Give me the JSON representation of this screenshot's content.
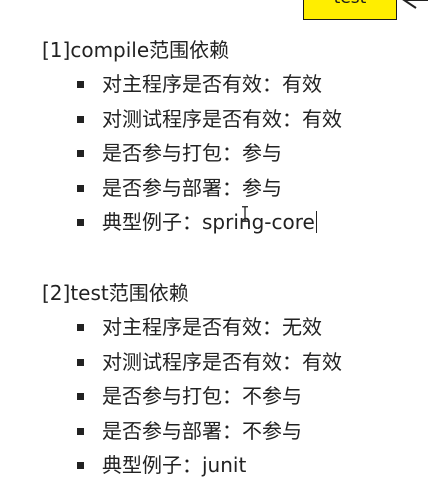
{
  "top_tag": {
    "label": "test",
    "fill_color": "#ffee00"
  },
  "sections": [
    {
      "title": "[1]compile范围依赖",
      "items": [
        "对主程序是否有效：有效",
        "对测试程序是否有效：有效",
        "是否参与打包：参与",
        "是否参与部署：参与",
        "典型例子：spring-core"
      ]
    },
    {
      "title": "[2]test范围依赖",
      "items": [
        "对主程序是否有效：无效",
        "对测试程序是否有效：有效",
        "是否参与打包：不参与",
        "是否参与部署：不参与",
        "典型例子：junit"
      ]
    }
  ],
  "cursor": {
    "type": "i-beam-icon"
  }
}
